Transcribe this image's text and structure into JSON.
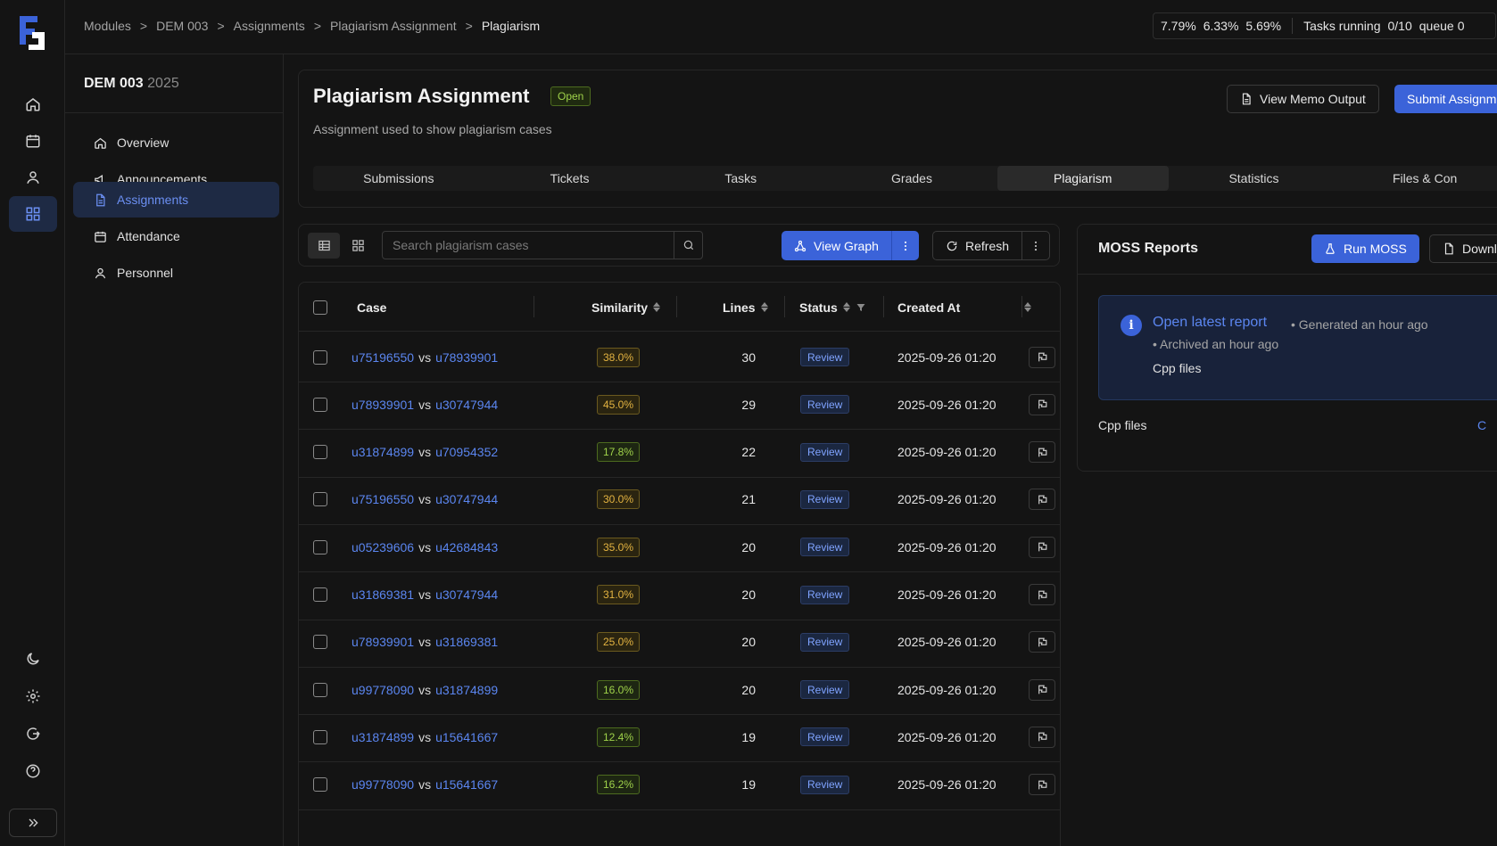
{
  "breadcrumbs": [
    "Modules",
    "DEM 003",
    "Assignments",
    "Plagiarism Assignment",
    "Plagiarism"
  ],
  "breadcrumb_separator": ">",
  "status": {
    "load_1": "7.79%",
    "load_2": "6.33%",
    "load_3": "5.69%",
    "tasks_label": "Tasks running",
    "tasks_value": "0/10",
    "queue_label": "queue",
    "queue_value": "0"
  },
  "module": {
    "code": "DEM 003",
    "year": "2025"
  },
  "sidebar": {
    "items": [
      {
        "label": "Overview",
        "icon": "home-icon"
      },
      {
        "label": "Announcements",
        "icon": "megaphone-icon"
      },
      {
        "label": "Assignments",
        "icon": "file-icon",
        "active": true
      },
      {
        "label": "Attendance",
        "icon": "calendar-icon"
      },
      {
        "label": "Personnel",
        "icon": "user-icon"
      }
    ]
  },
  "assignment": {
    "title": "Plagiarism Assignment",
    "status": "Open",
    "description": "Assignment used to show plagiarism cases",
    "view_memo_label": "View Memo Output",
    "submit_label": "Submit Assignm"
  },
  "tabs": [
    "Submissions",
    "Tickets",
    "Tasks",
    "Grades",
    "Plagiarism",
    "Statistics",
    "Files & Con"
  ],
  "active_tab": "Plagiarism",
  "toolbar": {
    "search_placeholder": "Search plagiarism cases",
    "view_graph_label": "View Graph",
    "refresh_label": "Refresh"
  },
  "table": {
    "columns": {
      "case": "Case",
      "similarity": "Similarity",
      "lines": "Lines",
      "status": "Status",
      "created": "Created At"
    },
    "vs": "vs",
    "rows": [
      {
        "a": "u75196550",
        "b": "u78939901",
        "similarity": "38.0%",
        "lines": "30",
        "status": "Review",
        "created": "2025-09-26 01:20"
      },
      {
        "a": "u78939901",
        "b": "u30747944",
        "similarity": "45.0%",
        "lines": "29",
        "status": "Review",
        "created": "2025-09-26 01:20"
      },
      {
        "a": "u31874899",
        "b": "u70954352",
        "similarity": "17.8%",
        "lines": "22",
        "status": "Review",
        "created": "2025-09-26 01:20"
      },
      {
        "a": "u75196550",
        "b": "u30747944",
        "similarity": "30.0%",
        "lines": "21",
        "status": "Review",
        "created": "2025-09-26 01:20"
      },
      {
        "a": "u05239606",
        "b": "u42684843",
        "similarity": "35.0%",
        "lines": "20",
        "status": "Review",
        "created": "2025-09-26 01:20"
      },
      {
        "a": "u31869381",
        "b": "u30747944",
        "similarity": "31.0%",
        "lines": "20",
        "status": "Review",
        "created": "2025-09-26 01:20"
      },
      {
        "a": "u78939901",
        "b": "u31869381",
        "similarity": "25.0%",
        "lines": "20",
        "status": "Review",
        "created": "2025-09-26 01:20"
      },
      {
        "a": "u99778090",
        "b": "u31874899",
        "similarity": "16.0%",
        "lines": "20",
        "status": "Review",
        "created": "2025-09-26 01:20"
      },
      {
        "a": "u31874899",
        "b": "u15641667",
        "similarity": "12.4%",
        "lines": "19",
        "status": "Review",
        "created": "2025-09-26 01:20"
      },
      {
        "a": "u99778090",
        "b": "u15641667",
        "similarity": "16.2%",
        "lines": "19",
        "status": "Review",
        "created": "2025-09-26 01:20"
      }
    ]
  },
  "moss": {
    "title": "MOSS Reports",
    "run_label": "Run MOSS",
    "download_label": "Downl",
    "report_link": "Open latest report",
    "generated": "• Generated an hour ago",
    "archived": "• Archived an hour ago",
    "report_files": "Cpp files",
    "files_label": "Cpp files",
    "files_action": "C"
  },
  "colors": {
    "accent": "#3b63d9",
    "link": "#5b86f0",
    "sim_yellow": "#e3b341",
    "sim_green": "#9fd24a",
    "open_green": "#9fd24a"
  }
}
